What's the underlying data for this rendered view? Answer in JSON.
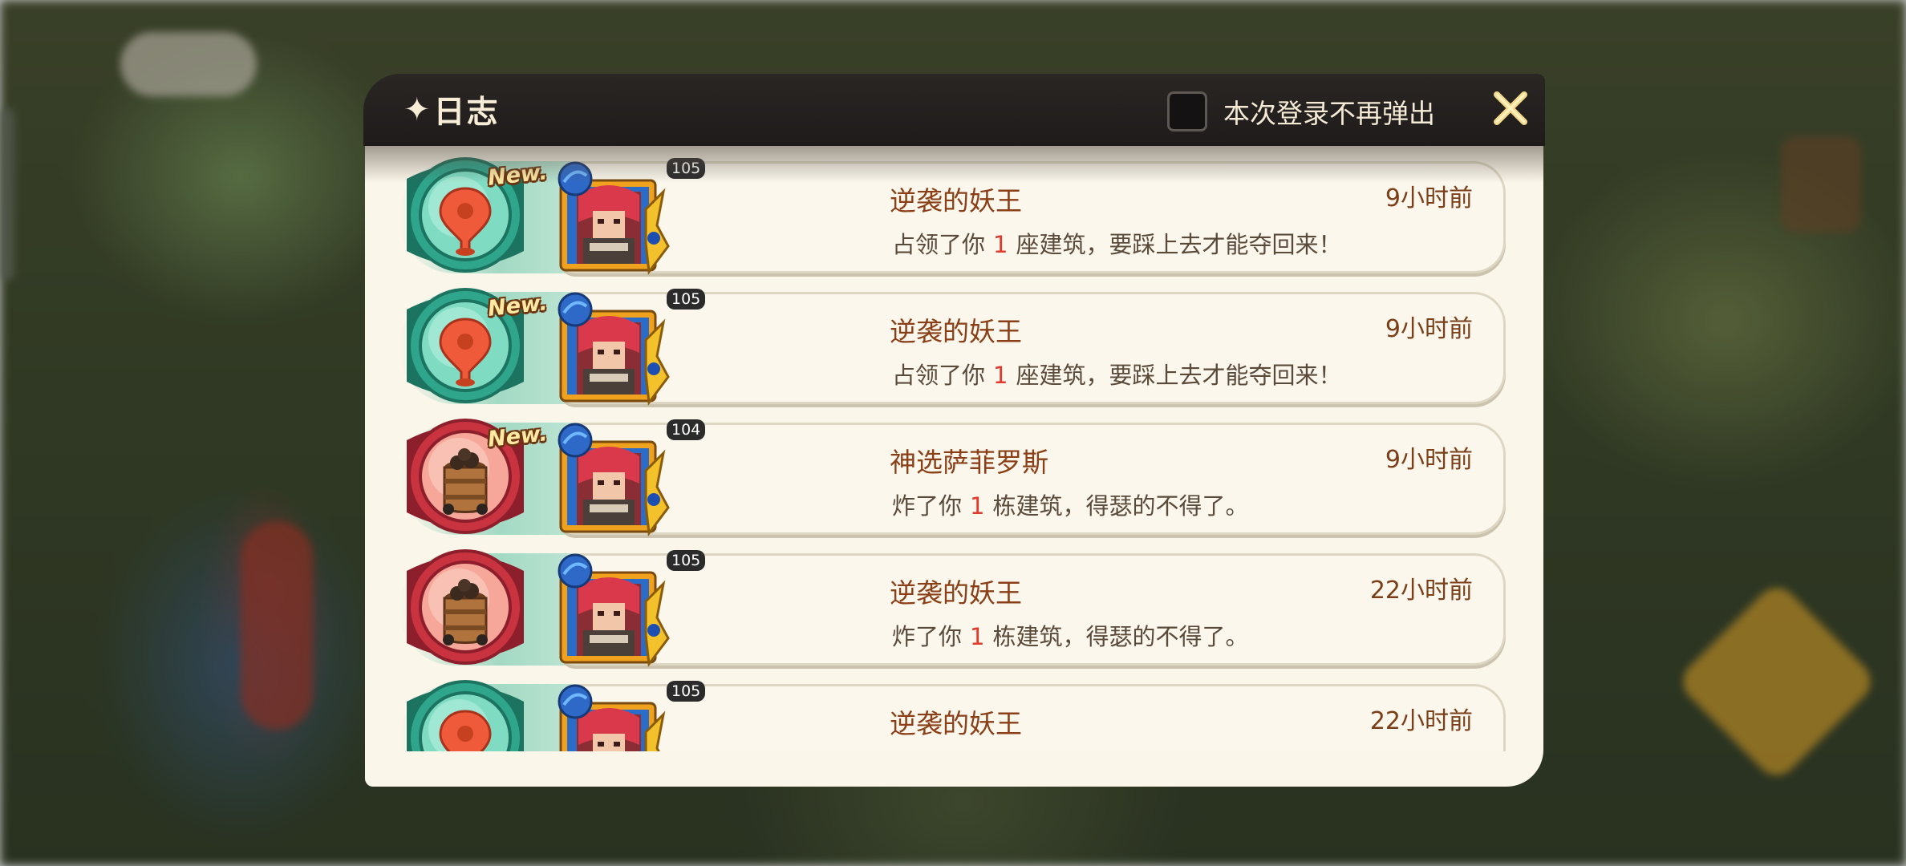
{
  "dialog": {
    "title": "日志",
    "dont_show_label": "本次登录不再弹出",
    "dont_show_checked": false
  },
  "entries": [
    {
      "type": "occupy",
      "type_icon": "map-pin-icon",
      "is_new": true,
      "new_label": "New.",
      "level": "105",
      "name": "逆袭的妖王",
      "time": "9小时前",
      "msg_before": "占领了你",
      "msg_num": "1",
      "msg_after": "座建筑，要踩上去才能夺回来！"
    },
    {
      "type": "occupy",
      "type_icon": "map-pin-icon",
      "is_new": true,
      "new_label": "New.",
      "level": "105",
      "name": "逆袭的妖王",
      "time": "9小时前",
      "msg_before": "占领了你",
      "msg_num": "1",
      "msg_after": "座建筑，要踩上去才能夺回来！"
    },
    {
      "type": "bomb",
      "type_icon": "powder-barrel-icon",
      "is_new": true,
      "new_label": "New.",
      "level": "104",
      "name": "神选萨菲罗斯",
      "time": "9小时前",
      "msg_before": "炸了你",
      "msg_num": "1",
      "msg_after": "栋建筑，得瑟的不得了。"
    },
    {
      "type": "bomb",
      "type_icon": "powder-barrel-icon",
      "is_new": false,
      "new_label": "",
      "level": "105",
      "name": "逆袭的妖王",
      "time": "22小时前",
      "msg_before": "炸了你",
      "msg_num": "1",
      "msg_after": "栋建筑，得瑟的不得了。"
    },
    {
      "type": "occupy",
      "type_icon": "map-pin-icon",
      "is_new": false,
      "new_label": "",
      "level": "105",
      "name": "逆袭的妖王",
      "time": "22小时前",
      "msg_before": "",
      "msg_num": "",
      "msg_after": ""
    }
  ],
  "colors": {
    "header_bg": "#221f1e",
    "body_bg": "#fbf6ea",
    "name": "#8a3f17",
    "highlight_number": "#e13a2d",
    "occupy_badge": "#2fa58c",
    "bomb_badge": "#c8333f"
  }
}
